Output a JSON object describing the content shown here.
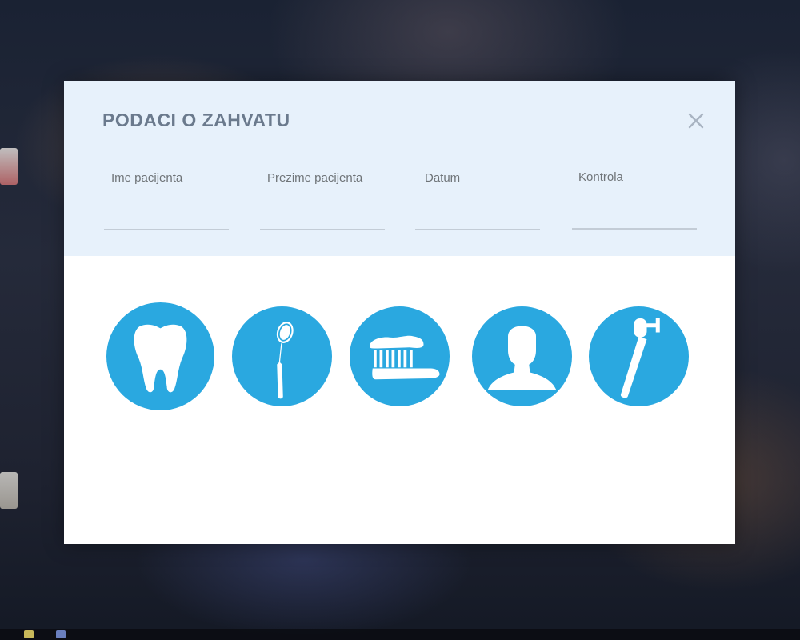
{
  "dialog": {
    "title": "PODACI O ZAHVATU",
    "close_icon": "close-icon"
  },
  "fields": [
    {
      "label": "Ime pacijenta",
      "value": "",
      "placeholder": ""
    },
    {
      "label": "Prezime pacijenta",
      "value": "",
      "placeholder": ""
    },
    {
      "label": "Datum",
      "value": "",
      "placeholder": ""
    },
    {
      "label": "Kontrola",
      "value": "",
      "placeholder": ""
    }
  ],
  "tools": [
    {
      "icon": "tooth-icon"
    },
    {
      "icon": "dental-mirror-icon"
    },
    {
      "icon": "toothbrush-icon"
    },
    {
      "icon": "patient-icon"
    },
    {
      "icon": "dental-drill-icon"
    }
  ],
  "colors": {
    "accent": "#2aa8e0",
    "header_bg": "#e7f1fb",
    "title": "#6b7a8d",
    "label": "#6f7478",
    "underline": "#c3ccd6"
  }
}
